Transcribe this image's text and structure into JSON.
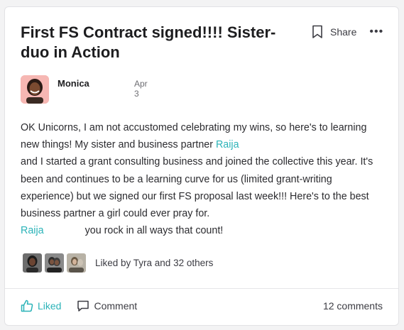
{
  "post": {
    "title": "First FS Contract signed!!!! Sister-duo in Action",
    "share_label": "Share",
    "more_label": "•••",
    "author": {
      "name": "Monica",
      "date": "Apr 3"
    },
    "body": {
      "line1": "OK Unicorns, I am not accustomed celebrating my wins, so here's to learning new things!  My sister and business partner ",
      "mention1": "Raija",
      "line2": "and I started a grant consulting business and joined the collective this year. It's been and continues to be a learning curve for us (limited grant-writing experience) but we signed our first FS proposal last week!!!  Here's to the best business partner a girl could ever pray for.",
      "mention2": "Raija",
      "line3": "you rock in all ways that count!"
    },
    "liked_by": "Liked by Tyra and 32 others",
    "footer": {
      "liked_label": "Liked",
      "comment_label": "Comment",
      "comments_count": "12 comments"
    },
    "colors": {
      "accent": "#2bb3b8",
      "avatar_bg": "#f6b7b3"
    }
  }
}
